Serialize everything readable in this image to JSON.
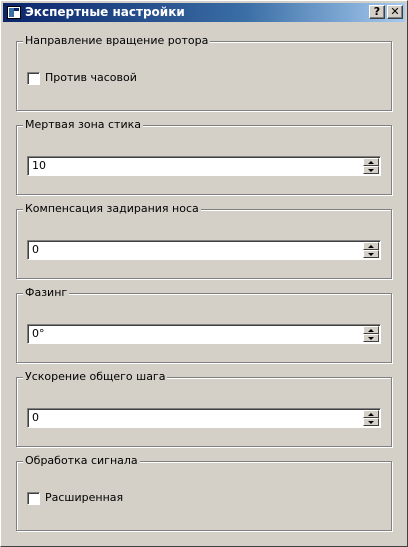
{
  "window": {
    "title": "Экспертные настройки",
    "help_button": "?",
    "close_button": "✕"
  },
  "groups": {
    "rotor": {
      "title": "Направление вращение ротора",
      "checkbox_label": "Против часовой",
      "checked": false
    },
    "deadzone": {
      "title": "Мертвая зона стика",
      "value": "10"
    },
    "nose": {
      "title": "Компенсация задирания носа",
      "value": "0"
    },
    "phasing": {
      "title": "Фазинг",
      "value": "0°"
    },
    "collective": {
      "title": "Ускорение общего шага",
      "value": "0"
    },
    "signal": {
      "title": "Обработка сигнала",
      "checkbox_label": "Расширенная",
      "checked": false
    }
  }
}
